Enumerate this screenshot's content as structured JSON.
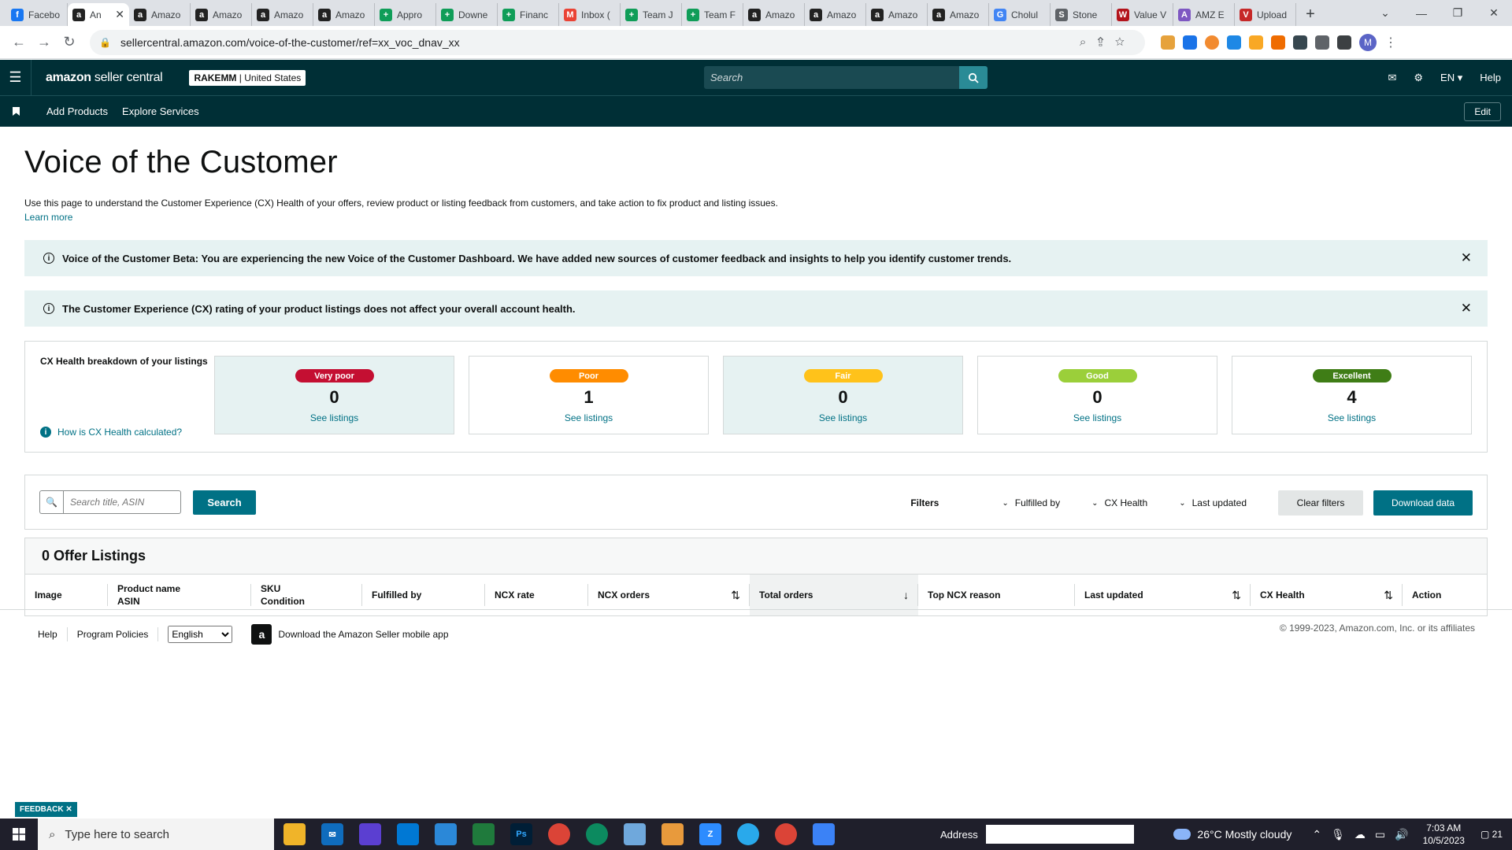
{
  "browser": {
    "tabs": [
      {
        "label": "Facebo",
        "color": "#1877f2",
        "glyph": "f"
      },
      {
        "label": "An",
        "color": "#222222",
        "glyph": "a",
        "active": true
      },
      {
        "label": "Amazo",
        "color": "#222222",
        "glyph": "a"
      },
      {
        "label": "Amazo",
        "color": "#222222",
        "glyph": "a"
      },
      {
        "label": "Amazo",
        "color": "#222222",
        "glyph": "a"
      },
      {
        "label": "Amazo",
        "color": "#222222",
        "glyph": "a"
      },
      {
        "label": "Appro",
        "color": "#0f9d58",
        "glyph": "+"
      },
      {
        "label": "Downe",
        "color": "#0f9d58",
        "glyph": "+"
      },
      {
        "label": "Financ",
        "color": "#0f9d58",
        "glyph": "+"
      },
      {
        "label": "Inbox (",
        "color": "#ea4335",
        "glyph": "M"
      },
      {
        "label": "Team J",
        "color": "#0f9d58",
        "glyph": "+"
      },
      {
        "label": "Team F",
        "color": "#0f9d58",
        "glyph": "+"
      },
      {
        "label": "Amazo",
        "color": "#222222",
        "glyph": "a"
      },
      {
        "label": "Amazo",
        "color": "#222222",
        "glyph": "a"
      },
      {
        "label": "Amazo",
        "color": "#222222",
        "glyph": "a"
      },
      {
        "label": "Amazo",
        "color": "#222222",
        "glyph": "a"
      },
      {
        "label": "Cholul",
        "color": "#4285f4",
        "glyph": "G"
      },
      {
        "label": "Stone",
        "color": "#5f6368",
        "glyph": "S"
      },
      {
        "label": "Value V",
        "color": "#b3131b",
        "glyph": "W"
      },
      {
        "label": "AMZ E",
        "color": "#7e57c2",
        "glyph": "A"
      },
      {
        "label": "Upload",
        "color": "#c62828",
        "glyph": "V"
      }
    ],
    "url": "sellercentral.amazon.com/voice-of-the-customer/ref=xx_voc_dnav_xx",
    "profile_initial": "M"
  },
  "header": {
    "logo_bold": "amazon",
    "logo_light": " seller central",
    "store_name": "RAKEMM",
    "store_region": "| United States",
    "search_placeholder": "Search",
    "language": "EN",
    "help": "Help"
  },
  "subnav": {
    "add_products": "Add Products",
    "explore_services": "Explore Services",
    "edit": "Edit"
  },
  "page": {
    "title": "Voice of the Customer",
    "description": "Use this page to understand the Customer Experience (CX) Health of your offers, review product or listing feedback from customers, and take action to fix product and listing issues.",
    "learn_more": "Learn more"
  },
  "alerts": {
    "beta": "Voice of the Customer Beta: You are experiencing the new Voice of the Customer Dashboard. We have added new sources of customer feedback and insights to help you identify customer trends.",
    "rating": "The Customer Experience (CX) rating of your product listings does not affect your overall account health."
  },
  "cx": {
    "label": "CX Health breakdown of your listings",
    "how": "How is CX Health calculated?",
    "cards": [
      {
        "name": "Very poor",
        "count": "0",
        "color": "#c40f32",
        "link": "See listings",
        "tinted": true
      },
      {
        "name": "Poor",
        "count": "1",
        "color": "#ff8c00",
        "link": "See listings",
        "tinted": false
      },
      {
        "name": "Fair",
        "count": "0",
        "color": "#ffc21a",
        "link": "See listings",
        "tinted": true
      },
      {
        "name": "Good",
        "count": "0",
        "color": "#9bcf3a",
        "link": "See listings",
        "tinted": false
      },
      {
        "name": "Excellent",
        "count": "4",
        "color": "#3f7d16",
        "link": "See listings",
        "tinted": false
      }
    ]
  },
  "filters": {
    "search_placeholder": "Search title, ASIN",
    "search_button": "Search",
    "label": "Filters",
    "fulfilled_by": "Fulfilled by",
    "cx_health": "CX Health",
    "last_updated": "Last updated",
    "clear": "Clear filters",
    "download": "Download data"
  },
  "listings": {
    "title": "0 Offer Listings",
    "columns": [
      {
        "line1": "Image",
        "line2": "",
        "width": 105,
        "sort": ""
      },
      {
        "line1": "Product name",
        "line2": "ASIN",
        "width": 182,
        "sort": ""
      },
      {
        "line1": "SKU",
        "line2": "Condition",
        "width": 141,
        "sort": ""
      },
      {
        "line1": "Fulfilled by",
        "line2": "",
        "width": 156,
        "sort": ""
      },
      {
        "line1": "NCX rate",
        "line2": "",
        "width": 131,
        "sort": ""
      },
      {
        "line1": "NCX orders",
        "line2": "",
        "width": 205,
        "sort": "⇅"
      },
      {
        "line1": "Total orders",
        "line2": "",
        "width": 214,
        "sort": "↓",
        "highlight": true
      },
      {
        "line1": "Top NCX reason",
        "line2": "",
        "width": 199,
        "sort": ""
      },
      {
        "line1": "Last updated",
        "line2": "",
        "width": 223,
        "sort": "⇅"
      },
      {
        "line1": "CX Health",
        "line2": "",
        "width": 193,
        "sort": "⇅"
      },
      {
        "line1": "Action",
        "line2": "",
        "width": 107,
        "sort": ""
      }
    ]
  },
  "footer": {
    "help": "Help",
    "policies": "Program Policies",
    "language": "English",
    "app": "Download the Amazon Seller mobile app",
    "copyright": "© 1999-2023, Amazon.com, Inc. or its affiliates"
  },
  "feedback": "FEEDBACK ✕",
  "taskbar": {
    "search": "Type here to search",
    "address": "Address",
    "weather": "26°C  Mostly cloudy",
    "time": "7:03 AM",
    "date": "10/5/2023",
    "notif": "21"
  }
}
